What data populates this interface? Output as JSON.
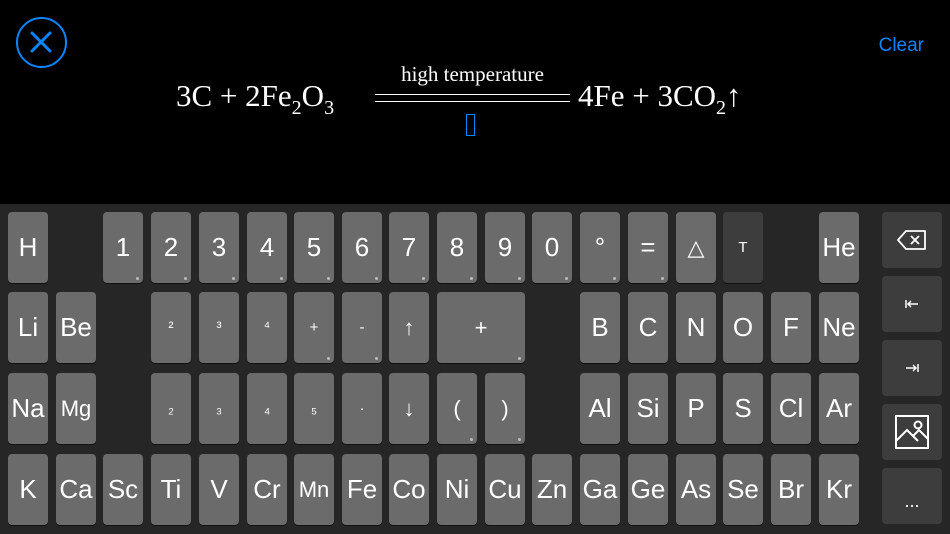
{
  "header": {
    "clear_label": "Clear",
    "close_icon": "close-icon"
  },
  "equation": {
    "left": "3C + 2Fe",
    "left_sub1": "2",
    "left_mid": "O",
    "left_sub2": "3",
    "condition": "high temperature",
    "right": "4Fe + 3CO",
    "right_sub": "2",
    "right_arrow": "↑"
  },
  "keyboard": {
    "row1": [
      "H",
      "1",
      "2",
      "3",
      "4",
      "5",
      "6",
      "7",
      "8",
      "9",
      "0",
      "°",
      "=",
      "△",
      "T",
      "He"
    ],
    "row2": [
      "Li",
      "Be",
      "²",
      "³",
      "⁴",
      "+",
      "-",
      "↑",
      "+",
      "B",
      "C",
      "N",
      "O",
      "F",
      "Ne"
    ],
    "row3": [
      "Na",
      "Mg",
      "₂",
      "₃",
      "₄",
      "₅",
      "·",
      "↓",
      "(",
      ")",
      "Al",
      "Si",
      "P",
      "S",
      "Cl",
      "Ar"
    ],
    "row4": [
      "K",
      "Ca",
      "Sc",
      "Ti",
      "V",
      "Cr",
      "Mn",
      "Fe",
      "Co",
      "Ni",
      "Cu",
      "Zn",
      "Ga",
      "Ge",
      "As",
      "Se",
      "Br",
      "Kr"
    ]
  },
  "side": {
    "backspace_icon": "backspace-icon",
    "cursor_left_icon": "cursor-start-icon",
    "cursor_right_icon": "cursor-end-icon",
    "image_icon": "image-icon",
    "more_label": "..."
  }
}
